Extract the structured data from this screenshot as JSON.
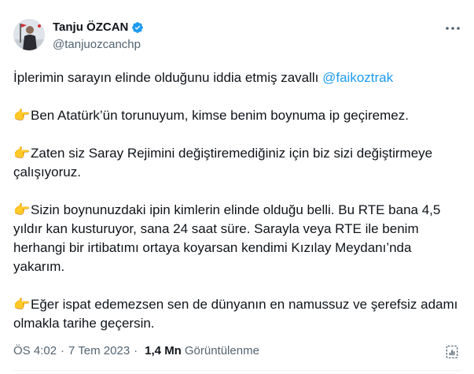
{
  "author": {
    "name": "Tanju ÖZCAN",
    "handle": "@tanjuozcanchp"
  },
  "icons": {
    "avatar": "profile-photo",
    "verified": "verified-badge-icon",
    "more": "more-options-icon",
    "bullet": "backhand-index-pointing-right-emoji",
    "stats": "post-analytics-icon"
  },
  "colors": {
    "accent": "#1d9bf0",
    "secondary_text": "#536471",
    "primary_text": "#0f1419"
  },
  "tweet": {
    "intro": "İplerimin sarayın elinde olduğunu iddia etmiş zavallı",
    "mention": "@faikoztrak",
    "bullet_emoji": "👉",
    "points": [
      "Ben Atatürk’ün torunuyum, kimse benim boynuma ip geçiremez.",
      "Zaten siz Saray Rejimini değiştiremediğiniz için biz sizi değiştirmeye çalışıyoruz.",
      "Sizin boynunuzdaki ipin kimlerin elinde olduğu belli. Bu RTE bana 4,5 yıldır kan kusturuyor, sana 24 saat süre. Sarayla veya RTE ile benim herhangi bir irtibatımı ortaya koyarsan kendimi Kızılay Meydanı’nda yakarım.",
      "Eğer ispat edemezsen sen de dünyanın en namussuz ve şerefsiz adamı olmakla tarihe geçersin."
    ]
  },
  "meta": {
    "time": "ÖS 4:02",
    "separator": "·",
    "date": "7 Tem 2023",
    "views_count": "1,4 Mn",
    "views_label": "Görüntülenme"
  }
}
